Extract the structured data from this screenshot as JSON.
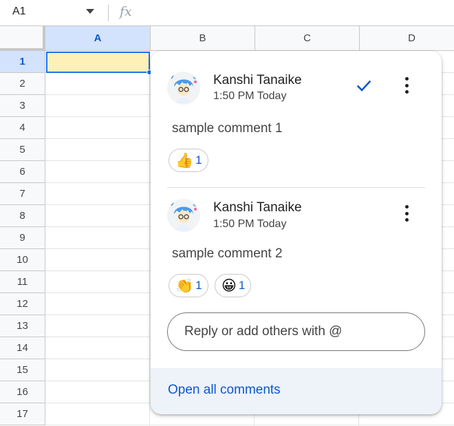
{
  "formula_bar": {
    "name_box": "A1",
    "fx_label": "fx"
  },
  "columns": [
    "A",
    "B",
    "C",
    "D"
  ],
  "rows": [
    "1",
    "2",
    "3",
    "4",
    "5",
    "6",
    "7",
    "8",
    "9",
    "10",
    "11",
    "12",
    "13",
    "14",
    "15",
    "16",
    "17"
  ],
  "selected_cell": "A1",
  "comment_card": {
    "comments": [
      {
        "author": "Kanshi Tanaike",
        "time": "1:50 PM Today",
        "text": "sample comment 1",
        "reactions": [
          {
            "emoji": "👍",
            "count": "1"
          }
        ]
      },
      {
        "author": "Kanshi Tanaike",
        "time": "1:50 PM Today",
        "text": "sample comment 2",
        "reactions": [
          {
            "emoji": "👏",
            "count": "1"
          },
          {
            "emoji": "😀",
            "count": "1"
          }
        ]
      }
    ],
    "reply_placeholder": "Reply or add others with @",
    "open_all_label": "Open all comments"
  },
  "colors": {
    "accent": "#0b57d0",
    "selection": "#1a73e8",
    "cell_fill": "#fef0b7",
    "header_selected": "#d3e3fd"
  }
}
